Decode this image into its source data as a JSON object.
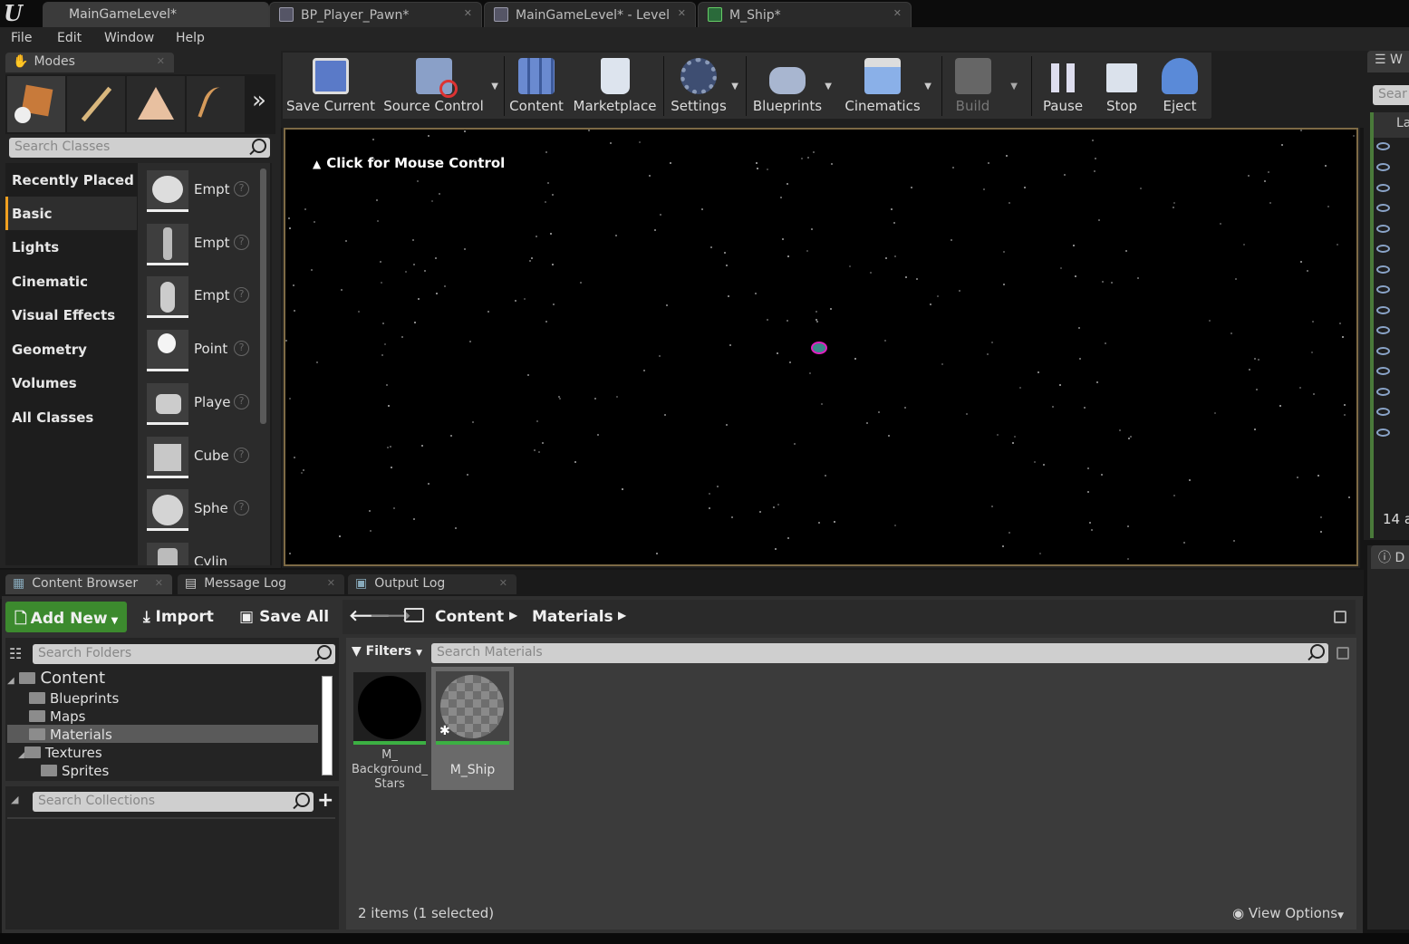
{
  "document_tabs": [
    {
      "label": "MainGameLevel*",
      "active": true
    },
    {
      "label": "BP_Player_Pawn*",
      "active": false
    },
    {
      "label": "MainGameLevel* - Level",
      "active": false
    },
    {
      "label": "M_Ship*",
      "active": false
    }
  ],
  "menu": [
    "File",
    "Edit",
    "Window",
    "Help"
  ],
  "modes": {
    "tab_label": "Modes",
    "search_placeholder": "Search Classes",
    "categories": [
      "Recently Placed",
      "Basic",
      "Lights",
      "Cinematic",
      "Visual Effects",
      "Geometry",
      "Volumes",
      "All Classes"
    ],
    "selected_category": "Basic",
    "items": [
      "Empt",
      "Empt",
      "Empt",
      "Point",
      "Playe",
      "Cube",
      "Sphe",
      "Cylin"
    ]
  },
  "toolbar": {
    "save_current": "Save Current",
    "source_control": "Source Control",
    "content": "Content",
    "marketplace": "Marketplace",
    "settings": "Settings",
    "blueprints": "Blueprints",
    "cinematics": "Cinematics",
    "build": "Build",
    "pause": "Pause",
    "stop": "Stop",
    "eject": "Eject"
  },
  "viewport": {
    "hint": "Click for Mouse Control"
  },
  "bottom_tabs": {
    "content_browser": "Content Browser",
    "message_log": "Message Log",
    "output_log": "Output Log"
  },
  "content_browser": {
    "add_new": "Add New",
    "import": "Import",
    "save_all": "Save All",
    "path": [
      "Content",
      "Materials"
    ],
    "search_folders": "Search Folders",
    "search_collections": "Search Collections",
    "filters": "Filters",
    "search_materials": "Search Materials",
    "tree": {
      "root": "Content",
      "blueprints": "Blueprints",
      "maps": "Maps",
      "materials": "Materials",
      "textures": "Textures",
      "sprites": "Sprites"
    },
    "selected_folder": "Materials",
    "assets": [
      {
        "name_line1": "M_",
        "name_line2": "Background_",
        "name_line3": "Stars",
        "selected": false
      },
      {
        "name_line1": "M_Ship",
        "selected": true
      }
    ],
    "status": "2 items (1 selected)",
    "view_options": "View Options"
  },
  "right_panel": {
    "tab_initial": "W",
    "search_partial": "Sear",
    "col_partial": "La",
    "count_partial": "14 a",
    "details_initial": "D"
  },
  "colors": {
    "add_new_green": "#3c8a2e",
    "asset_green": "#3cb043",
    "selected_accent": "#f0a020"
  }
}
